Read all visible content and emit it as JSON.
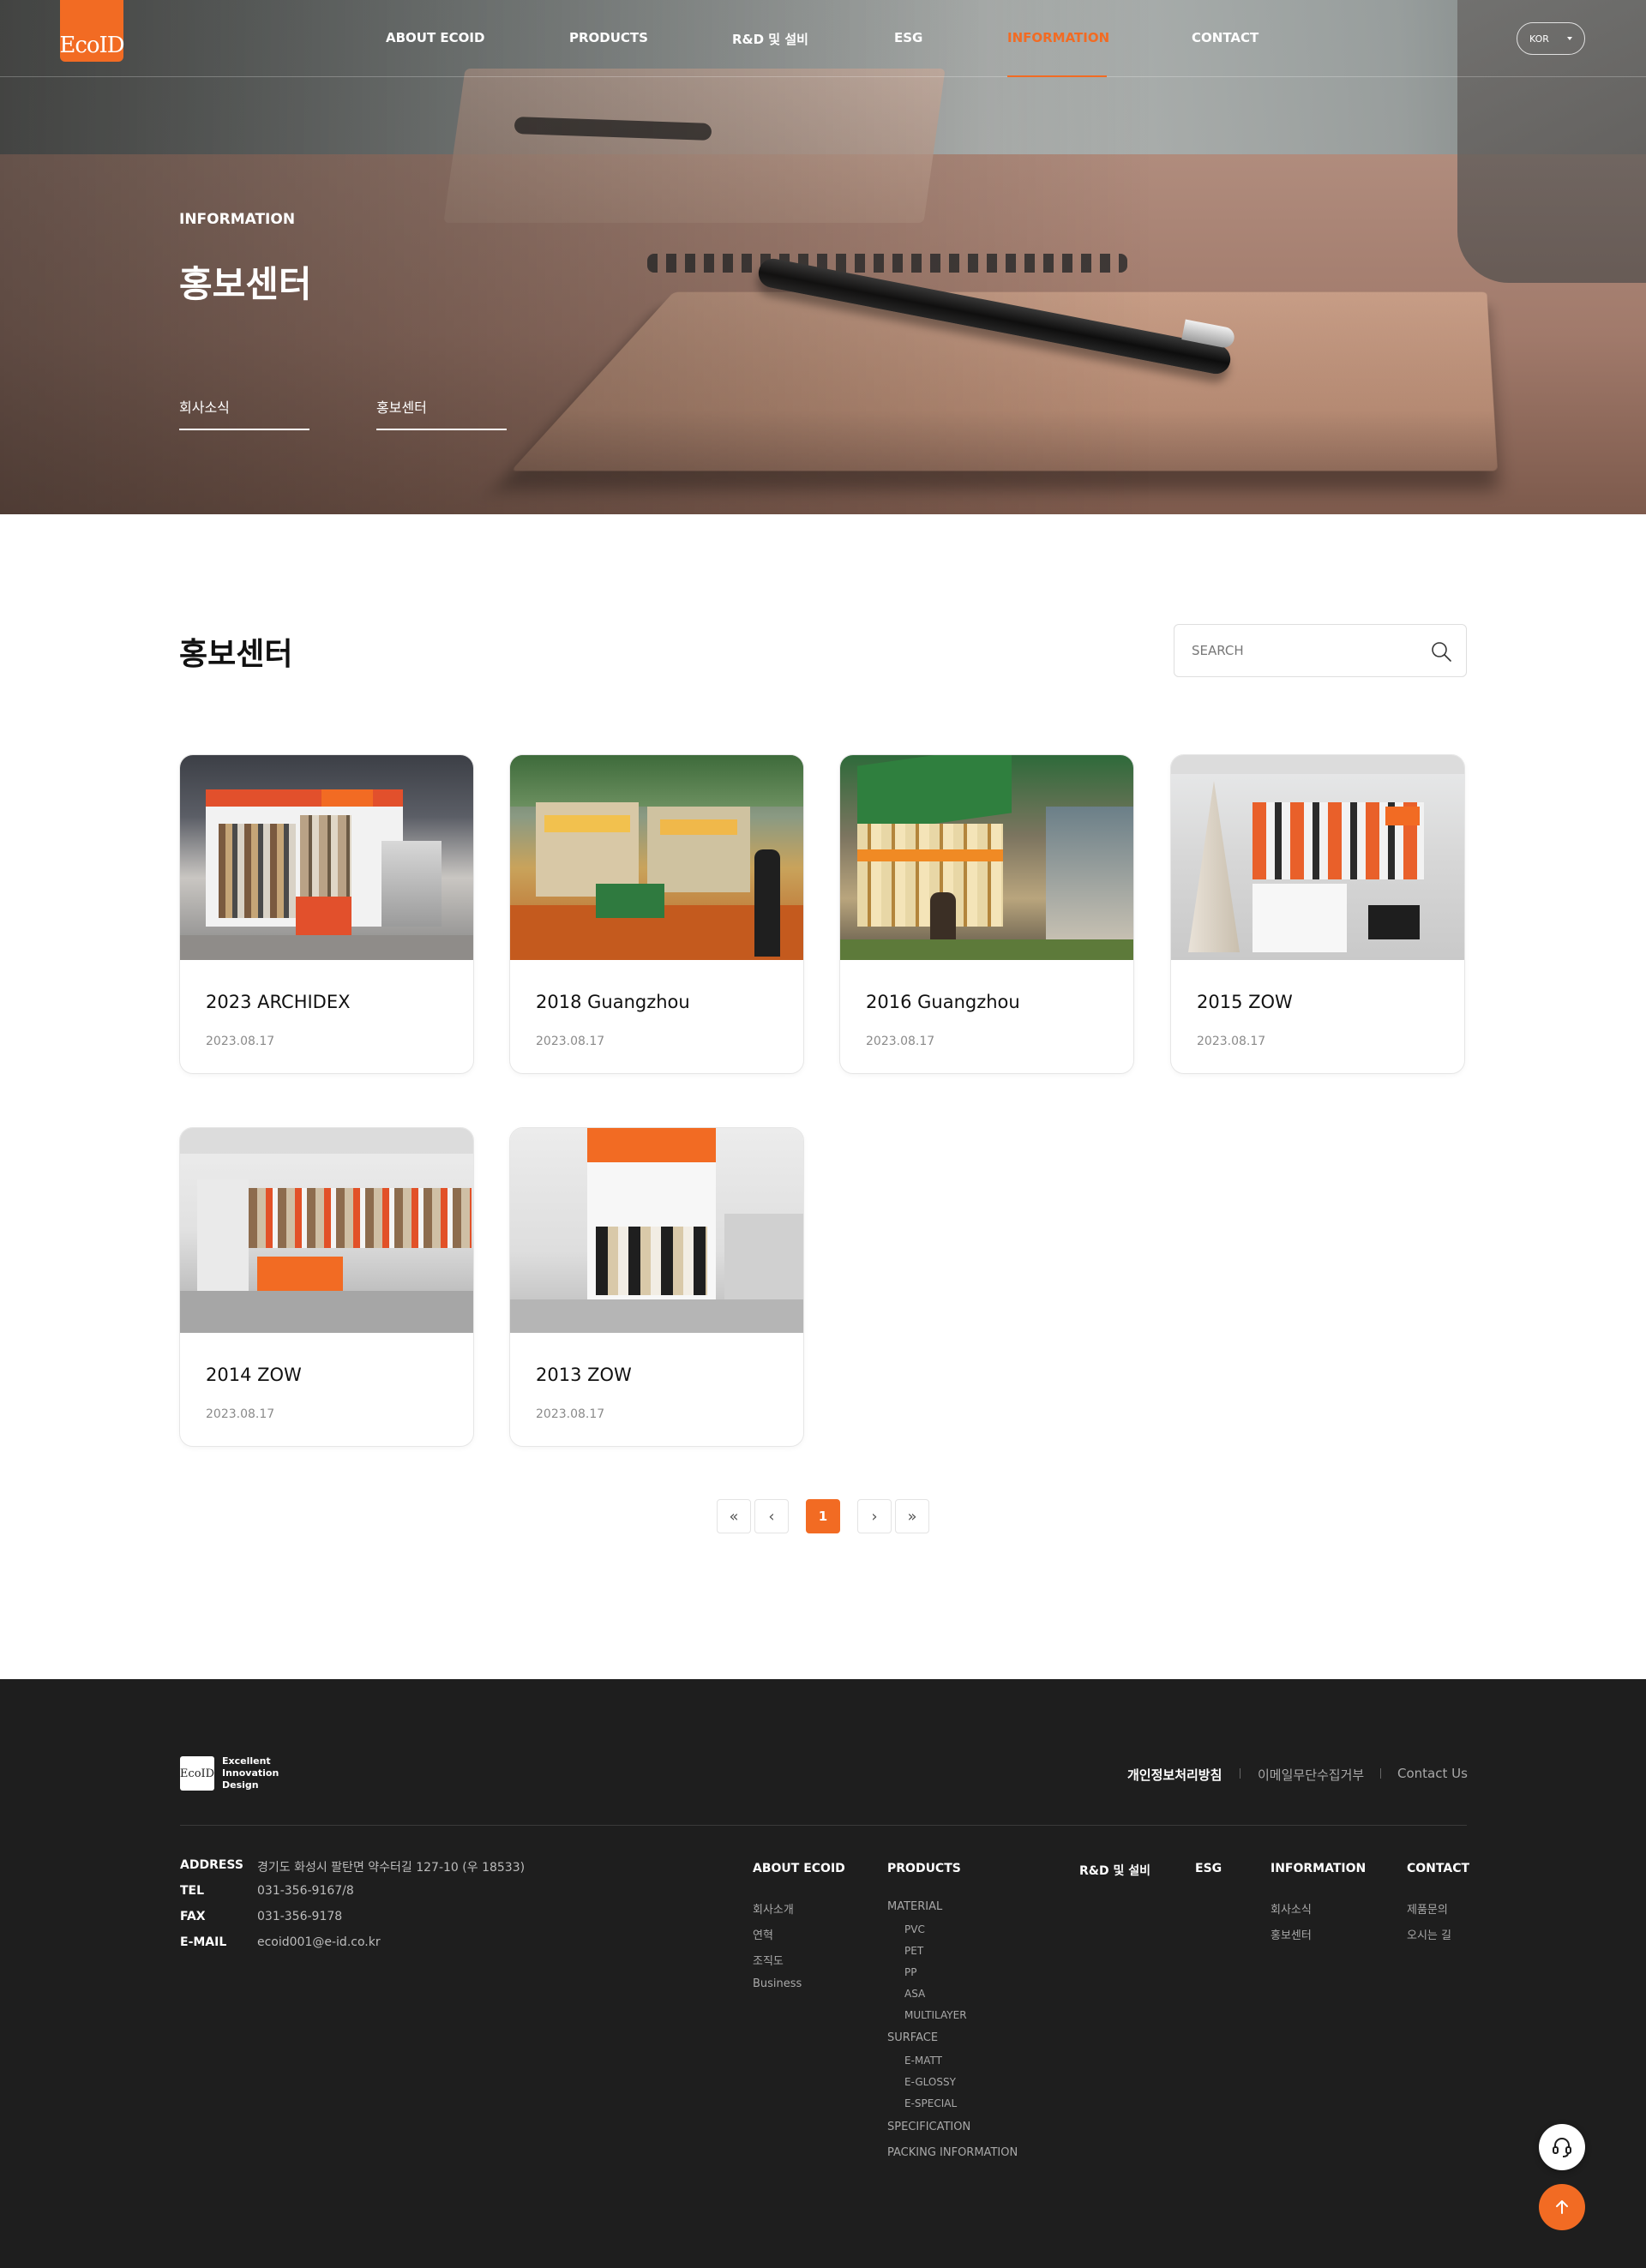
{
  "header": {
    "logo_text": "EcoID",
    "nav": [
      "ABOUT ECOID",
      "PRODUCTS",
      "R&D 및 설비",
      "ESG",
      "INFORMATION",
      "CONTACT"
    ],
    "active_nav": "INFORMATION",
    "language": "KOR"
  },
  "hero": {
    "eyebrow": "INFORMATION",
    "title": "홍보센터",
    "tabs": [
      "회사소식",
      "홍보센터"
    ]
  },
  "main": {
    "title": "홍보센터",
    "search_placeholder": "SEARCH",
    "cards": [
      {
        "title": "2023 ARCHIDEX",
        "date": "2023.08.17"
      },
      {
        "title": "2018 Guangzhou",
        "date": "2023.08.17"
      },
      {
        "title": "2016 Guangzhou",
        "date": "2023.08.17"
      },
      {
        "title": "2015 ZOW",
        "date": "2023.08.17"
      },
      {
        "title": "2014 ZOW",
        "date": "2023.08.17"
      },
      {
        "title": "2013 ZOW",
        "date": "2023.08.17"
      }
    ],
    "pagination": {
      "current": "1",
      "first": "«",
      "prev": "‹",
      "next": "›",
      "last": "»"
    }
  },
  "footer": {
    "tagline": [
      "Excellent",
      "Innovation",
      "Design"
    ],
    "links": [
      "개인정보처리방침",
      "이메일무단수집거부",
      "Contact Us"
    ],
    "info": [
      {
        "label": "ADDRESS",
        "value": "경기도 화성시 팔탄면 약수터길 127-10 (우 18533)"
      },
      {
        "label": "TEL",
        "value": "031-356-9167/8"
      },
      {
        "label": "FAX",
        "value": "031-356-9178"
      },
      {
        "label": "E-MAIL",
        "value": "ecoid001@e-id.co.kr"
      }
    ],
    "sitemap": {
      "about": {
        "title": "ABOUT ECOID",
        "items": [
          "회사소개",
          "연혁",
          "조직도",
          "Business"
        ]
      },
      "products": {
        "title": "PRODUCTS",
        "material": "MATERIAL",
        "material_items": [
          "PVC",
          "PET",
          "PP",
          "ASA",
          "MULTILAYER"
        ],
        "surface": "SURFACE",
        "surface_items": [
          "E-MATT",
          "E-GLOSSY",
          "E-SPECIAL"
        ],
        "specification": "SPECIFICATION",
        "packing": "PACKING INFORMATION"
      },
      "rnd": {
        "title": "R&D 및 설비"
      },
      "esg": {
        "title": "ESG"
      },
      "information": {
        "title": "INFORMATION",
        "items": [
          "회사소식",
          "홍보센터"
        ]
      },
      "contact": {
        "title": "CONTACT",
        "items": [
          "제품문의",
          "오시는 길"
        ]
      }
    }
  },
  "colors": {
    "accent": "#f26b23",
    "footer_bg": "#1e1e1e"
  },
  "icons": {
    "search": "search-icon",
    "support": "headset-icon",
    "top": "arrow-up-icon"
  }
}
